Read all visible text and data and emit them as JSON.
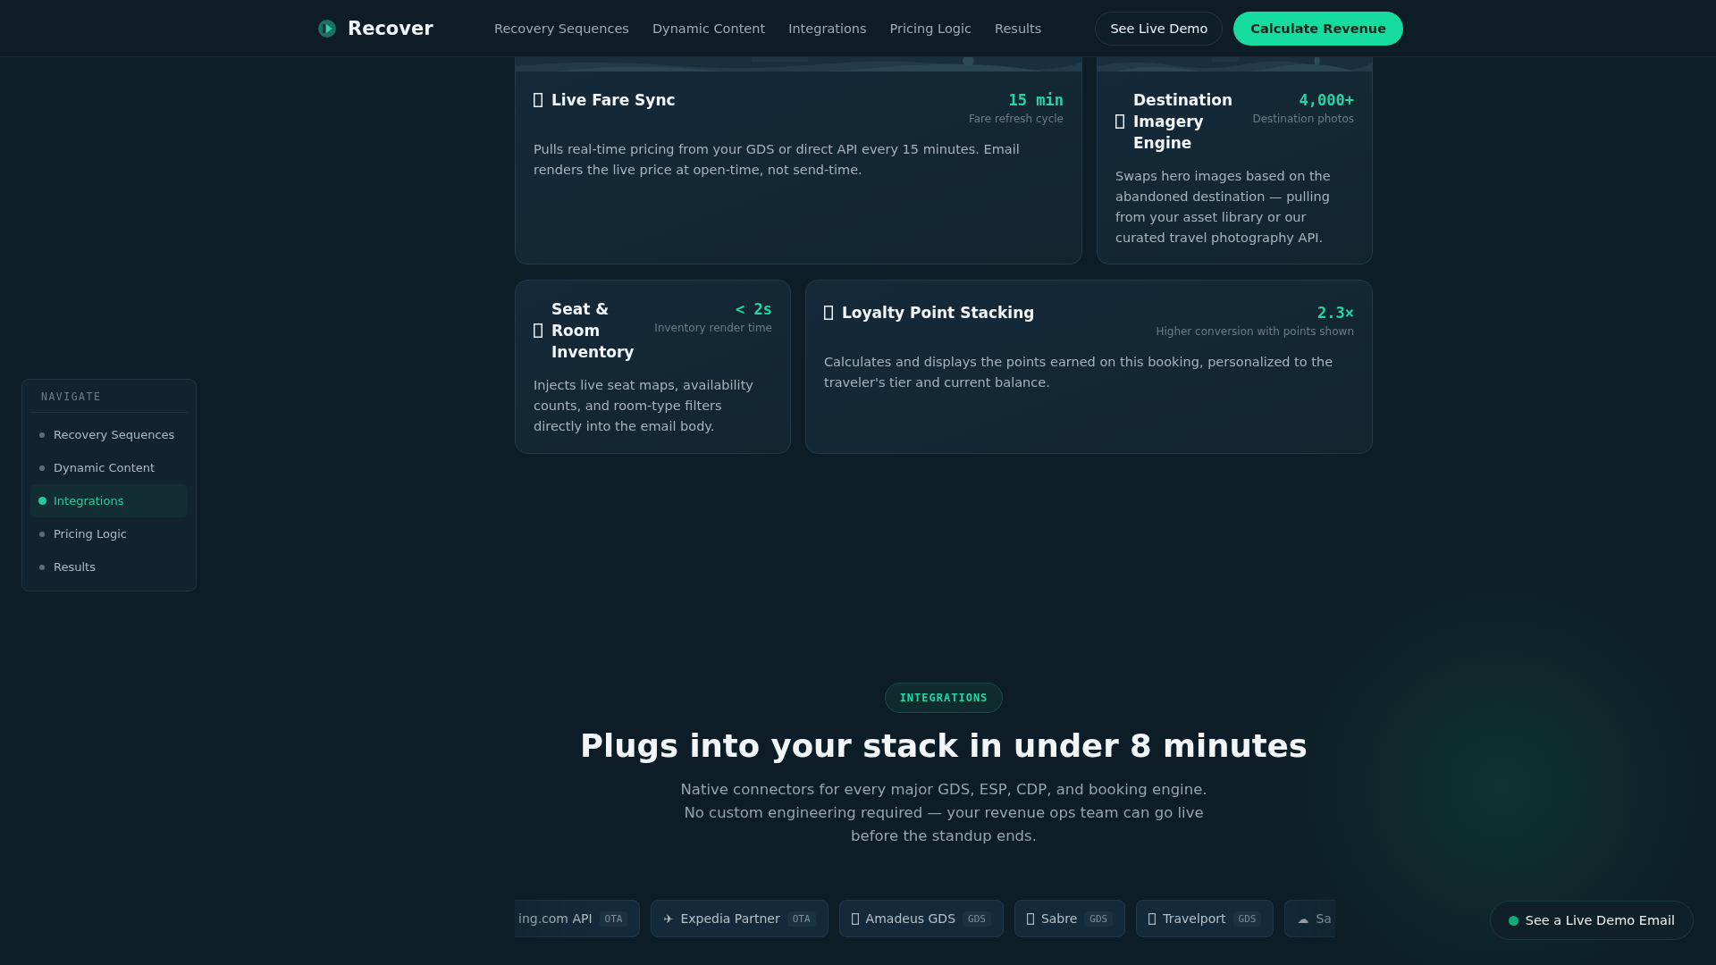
{
  "nav": {
    "brand": "Recover",
    "links": [
      "Recovery Sequences",
      "Dynamic Content",
      "Integrations",
      "Pricing Logic",
      "Results"
    ],
    "secondary_button": "See Live Demo",
    "primary_button": "Calculate Revenue"
  },
  "sidebar": {
    "heading": "NAVIGATE",
    "items": [
      {
        "label": "Recovery Sequences",
        "selected": false
      },
      {
        "label": "Dynamic Content",
        "selected": false
      },
      {
        "label": "Integrations",
        "selected": true
      },
      {
        "label": "Pricing Logic",
        "selected": false
      },
      {
        "label": "Results",
        "selected": false
      }
    ]
  },
  "feature_rows": [
    [
      {
        "title": "Live Fare Sync",
        "stat": "15 min",
        "stat_label": "Fare refresh cycle",
        "description": "Pulls real-time pricing from your GDS or direct API every 15 minutes. Email renders the live price at open-time, not send-time."
      },
      {
        "title": "Destination Imagery Engine",
        "stat": "4,000+",
        "stat_label": "Destination photos",
        "description": "Swaps hero images based on the abandoned destination — pulling from your asset library or our curated travel photography API."
      }
    ],
    [
      {
        "kind": "plain",
        "title": "Seat & Room Inventory",
        "stat": "< 2s",
        "stat_label": "Inventory render time",
        "description": "Injects live seat maps, availability counts, and room-type filters directly into the email body."
      },
      {
        "kind": "plain",
        "title": "Loyalty Point Stacking",
        "stat": "2.3×",
        "stat_label": "Higher conversion with points shown",
        "description": "Calculates and displays the points earned on this booking, personalized to the traveler's tier and current balance."
      }
    ]
  ],
  "integrations": {
    "badge": "INTEGRATIONS",
    "title": "Plugs into your stack in under 8 minutes",
    "subtitle_lines": [
      "Native connectors for every major GDS, ESP, CDP, and booking engine.",
      "No custom engineering required — your revenue ops team can go live",
      "before the standup ends."
    ],
    "chips": [
      {
        "kind": "none",
        "name": "ing.com API",
        "tag": "OTA"
      },
      {
        "kind": "glyph",
        "glyph": "✈",
        "name": "Expedia Partner",
        "tag": "OTA"
      },
      {
        "kind": "box",
        "name": "Amadeus GDS",
        "tag": "GDS"
      },
      {
        "kind": "box",
        "name": "Sabre",
        "tag": "GDS"
      },
      {
        "kind": "box",
        "name": "Travelport",
        "tag": "GDS"
      },
      {
        "kind": "glyph",
        "glyph": "☁",
        "name": "Sa"
      }
    ]
  },
  "floating_button": "See a Live Demo Email"
}
